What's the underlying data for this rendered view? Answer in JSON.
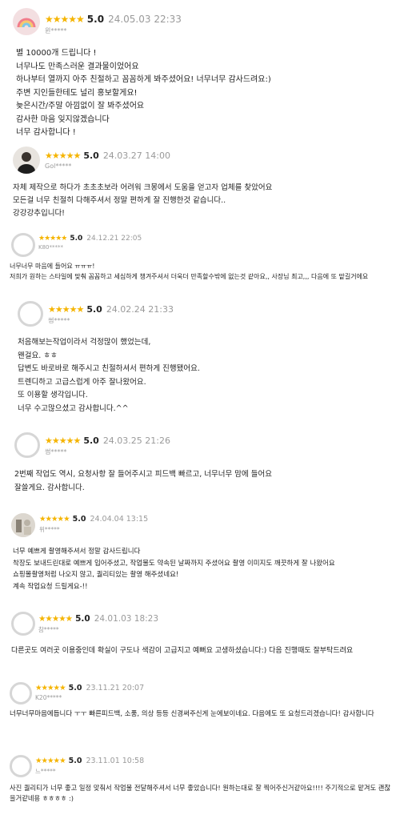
{
  "rating_stars": "★★★★★",
  "colors": {
    "star": "#f5b400",
    "date": "#9a9a9a",
    "text": "#222222"
  },
  "reviews": [
    {
      "avatar": "rainbow-avatar",
      "score": "5.0",
      "date": "24.05.03 22:33",
      "user": "윈*****",
      "lines": [
        "별 10000개 드립니다 !",
        "너무나도 만족스러운 결과물이었어요",
        "하나부터 열까지 아주 친절하고 꼼꼼하게 봐주셨어요! 너무너무 감사드려요:)",
        "주변 지인들한테도 널리 홍보할게요!",
        "늦은시간/주말 아낌없이 잘 봐주셨어요",
        "감사한 마음 잊지않겠습니다",
        "너무 감사합니다 !"
      ]
    },
    {
      "avatar": "person-photo-avatar",
      "score": "5.0",
      "date": "24.03.27 14:00",
      "user": "Gol*****",
      "lines": [
        "자체 제작으로 하다가  초초초보라 어려워 크몽에서 도움을 얻고자 업체를 찾았어요",
        "모든걸 너무 친절히 다해주셔서 정말 편하게 잘 진행한것 같습니다..",
        "강강강추입니다!"
      ]
    },
    {
      "avatar": "default-avatar",
      "score": "5.0",
      "date": "24.12.21 22:05",
      "user": "K80*****",
      "lines": [
        "너무너무 마음에 들어요 ㅠㅠㅠ!",
        "저희가 원하는 스타일에 맞춰 꼼꼼하고 세심하게 챙겨주셔서 더욱더 만족할수밖에 없는것 같아요,, 사장님 최고,,, 다음에 또 맡길거에요"
      ]
    },
    {
      "avatar": "default-avatar",
      "score": "5.0",
      "date": "24.02.24 21:33",
      "user": "썸*****",
      "lines": [
        "처음해보는작업이라서 걱정많이 했었는데,",
        "왠걸요. ㅎㅎ",
        "답변도 바로바로 해주시고 친절하셔서 편하게 진행됐어요.",
        "트렌디하고 고급스럽게 아주 잘나왔어요.",
        "또 이용할 생각입니다.",
        "너무 수고많으셨고 감사합니다.^^"
      ]
    },
    {
      "avatar": "default-avatar",
      "score": "5.0",
      "date": "24.03.25 21:26",
      "user": "썸*****",
      "lines": [
        "2번째 작업도 역시, 요청사항 잘 들어주시고 피드백 빠르고, 너무너무 맘에 들어요",
        "잘쓸게요. 감사합니다."
      ]
    },
    {
      "avatar": "photo-avatar",
      "score": "5.0",
      "date": "24.04.04 13:15",
      "user": "위*****",
      "lines": [
        "너무 예쁘게 촬영해주셔서 정말 감사드립니다",
        "착장도 보내드린대로 예쁘게 입어주셨고, 작업물도 약속된 날짜까지 주셨어요 촬영 이미지도 깨끗하게 잘 나왔어요",
        "쇼핑몰촬영처럼 나오지 않고, 퀄리티있는 촬영 해주셨네요!",
        "계속 작업요청 드릴게요-!!"
      ]
    },
    {
      "avatar": "default-avatar",
      "score": "5.0",
      "date": "24.01.03 18:23",
      "user": "참*****",
      "lines": [
        "다른곳도 여러곳 이용중인데 확실이 구도나 색감이 고급지고 예뻐요 고생하셨습니다:) 다음 진행때도 잘부탁드려요"
      ]
    },
    {
      "avatar": "default-avatar",
      "score": "5.0",
      "date": "23.11.21 20:07",
      "user": "K20*****",
      "lines": [
        "너무너무마음에듭니다 ㅜㅜ 빠른피드백, 소품, 의상 등등 신경써주신게 눈에보이네요. 다음에도 또 요청드리겠습니다! 감사합니다"
      ]
    },
    {
      "avatar": "default-avatar",
      "score": "5.0",
      "date": "23.11.01 10:58",
      "user": "느*****",
      "lines": [
        "사진 퀄리티가 너무 좋고 일정 맞춰서 작업물 전달해주셔서 너무 좋았습니다! 원하는대로 잘 찍어주신거같아요!!!! 주기적으로 맡겨도 괜찮을거같네용 ㅎㅎㅎㅎ :)"
      ]
    }
  ]
}
